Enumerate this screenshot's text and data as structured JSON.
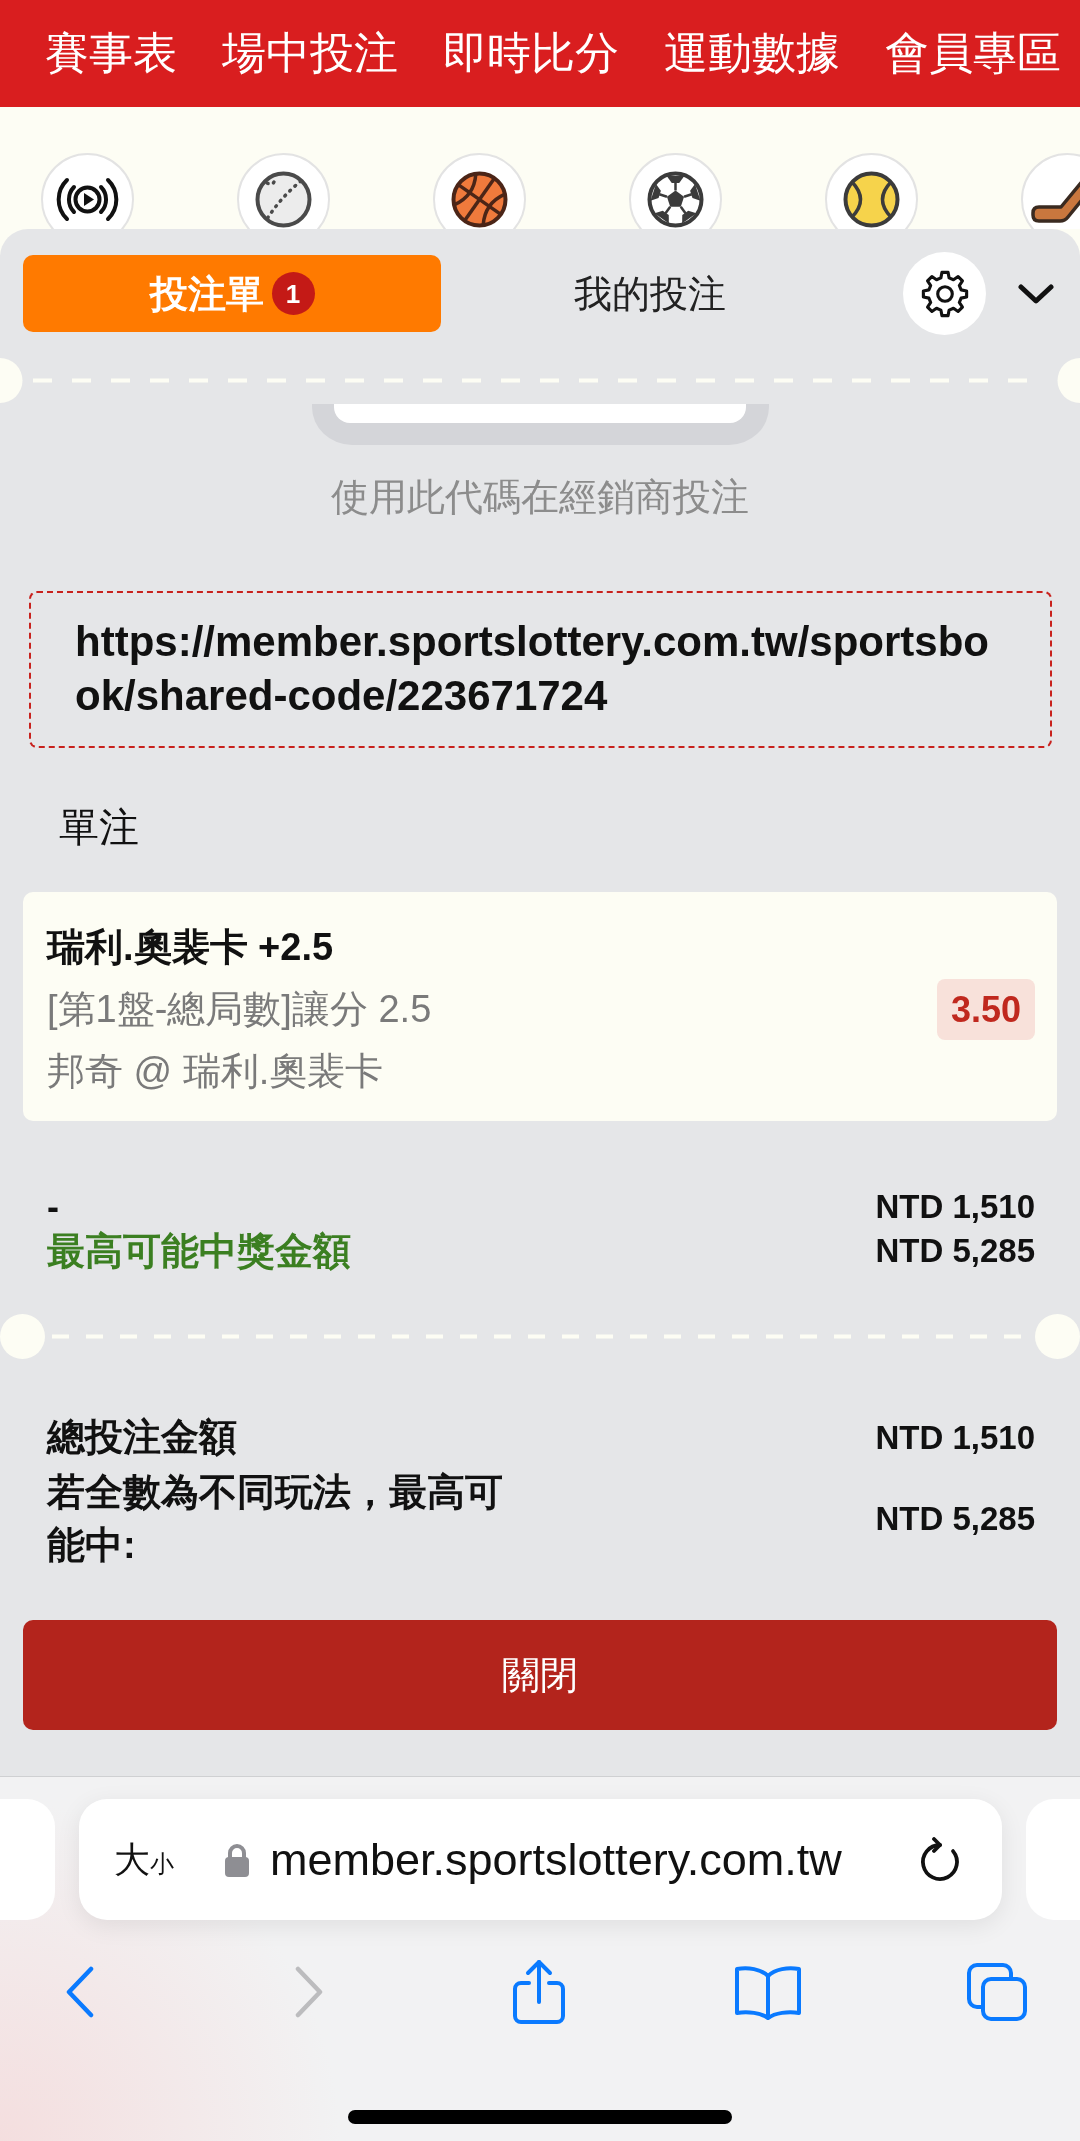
{
  "top_nav": {
    "items": [
      "賽事表",
      "場中投注",
      "即時比分",
      "運動數據",
      "會員專區"
    ]
  },
  "sports": [
    {
      "kind": "live"
    },
    {
      "kind": "baseball"
    },
    {
      "kind": "basketball"
    },
    {
      "kind": "soccer"
    },
    {
      "kind": "tennis"
    },
    {
      "kind": "hockey"
    }
  ],
  "bet_slip": {
    "tabs": [
      {
        "label": "投注單",
        "selected": true,
        "badge": "1"
      },
      {
        "label": "我的投注",
        "selected": false
      }
    ],
    "code_hint": "使用此代碼在經銷商投注",
    "share_link": "https://member.sportslottery.com.tw/sportsbook/shared-code/223671724",
    "section_title": "單注",
    "selections": [
      {
        "title": "瑞利.奧裴卡 +2.5",
        "market": "[第1盤-總局數]讓分 2.5",
        "event": "邦奇 @ 瑞利.奧裴卡",
        "odds": "3.50"
      }
    ],
    "stake_rows": [
      {
        "kind": "plain",
        "label": "-",
        "value": "NTD 1,510"
      },
      {
        "kind": "payout",
        "label": "最高可能中獎金額",
        "value": "NTD 5,285"
      }
    ],
    "summary": [
      {
        "label": "總投注金額",
        "value": "NTD 1,510"
      },
      {
        "label": "若全數為不同玩法，最高可能中:",
        "value": "NTD 5,285"
      }
    ],
    "close_button": "關閉"
  },
  "browser": {
    "text_size": {
      "large": "大",
      "small": "小"
    },
    "url": "member.sportslottery.com.tw",
    "toolbar": [
      {
        "kind": "back",
        "disabled": false
      },
      {
        "kind": "forward",
        "disabled": true
      },
      {
        "kind": "share",
        "disabled": false
      },
      {
        "kind": "bookmarks",
        "disabled": false
      },
      {
        "kind": "tabs",
        "disabled": false
      }
    ]
  }
}
